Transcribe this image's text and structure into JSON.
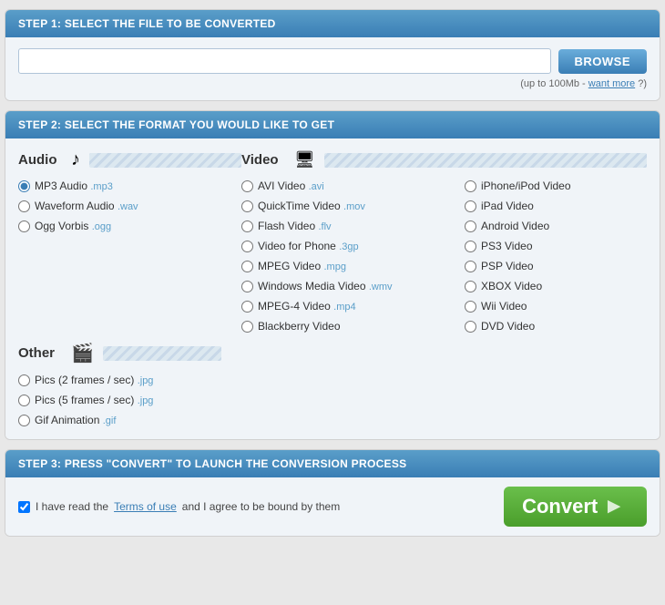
{
  "step1": {
    "header": "STEP 1: SELECT THE FILE TO BE CONVERTED",
    "browse_label": "BROWSE",
    "file_note": "(up to 100Mb -",
    "want_more": "want more",
    "file_note_end": "?)",
    "input_placeholder": ""
  },
  "step2": {
    "header": "STEP 2: SELECT THE FORMAT YOU WOULD LIKE TO GET",
    "audio_label": "Audio",
    "video_label": "Video",
    "other_label": "Other",
    "audio_formats": [
      {
        "label": "MP3 Audio",
        "tag": ".mp3",
        "checked": true
      },
      {
        "label": "Waveform Audio",
        "tag": ".wav",
        "checked": false
      },
      {
        "label": "Ogg Vorbis",
        "tag": ".ogg",
        "checked": false
      }
    ],
    "video_col1": [
      {
        "label": "AVI Video",
        "tag": ".avi"
      },
      {
        "label": "QuickTime Video",
        "tag": ".mov"
      },
      {
        "label": "Flash Video",
        "tag": ".flv"
      },
      {
        "label": "Video for Phone",
        "tag": ".3gp"
      },
      {
        "label": "MPEG Video",
        "tag": ".mpg"
      },
      {
        "label": "Windows Media Video",
        "tag": ".wmv"
      },
      {
        "label": "MPEG-4 Video",
        "tag": ".mp4"
      },
      {
        "label": "Blackberry Video",
        "tag": ""
      }
    ],
    "video_col2": [
      {
        "label": "iPhone/iPod Video",
        "tag": ""
      },
      {
        "label": "iPad Video",
        "tag": ""
      },
      {
        "label": "Android Video",
        "tag": ""
      },
      {
        "label": "PS3 Video",
        "tag": ""
      },
      {
        "label": "PSP Video",
        "tag": ""
      },
      {
        "label": "XBOX Video",
        "tag": ""
      },
      {
        "label": "Wii Video",
        "tag": ""
      },
      {
        "label": "DVD Video",
        "tag": ""
      }
    ],
    "other_formats": [
      {
        "label": "Pics (2 frames / sec)",
        "tag": ".jpg"
      },
      {
        "label": "Pics (5 frames / sec)",
        "tag": ".jpg"
      },
      {
        "label": "Gif Animation",
        "tag": ".gif"
      }
    ]
  },
  "step3": {
    "header": "STEP 3: PRESS \"CONVERT\" TO LAUNCH THE CONVERSION PROCESS",
    "terms_prefix": "I have read the",
    "terms_link": "Terms of use",
    "terms_suffix": "and I agree to be bound by them",
    "convert_label": "Convert"
  }
}
